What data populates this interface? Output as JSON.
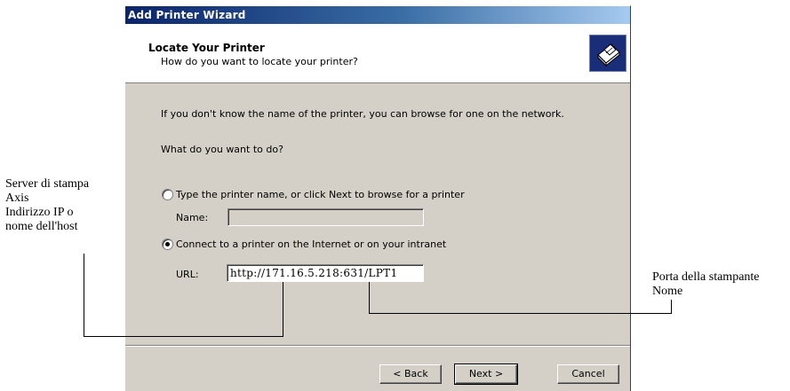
{
  "window": {
    "title": "Add Printer Wizard"
  },
  "header": {
    "title": "Locate Your Printer",
    "subtitle": "How do you want to locate your printer?",
    "icon": "printer-icon"
  },
  "body": {
    "intro": "If you don't know the name of the printer, you can browse for one on the network.",
    "question": "What do you want to do?",
    "option_type_name": "Type the printer name, or click Next to browse for a printer",
    "name_label": "Name:",
    "name_value": "",
    "option_connect": "Connect to a printer on the Internet or on your intranet",
    "url_label": "URL:",
    "url_value": "http://171.16.5.218:631/LPT1",
    "selected_option": "connect"
  },
  "buttons": {
    "back": "< Back",
    "next": "Next >",
    "cancel": "Cancel"
  },
  "annotations": {
    "left": [
      "Server di stampa",
      "Axis",
      "Indirizzo IP o",
      "nome dell'host"
    ],
    "right": [
      "Porta della stampante",
      "Nome"
    ]
  }
}
